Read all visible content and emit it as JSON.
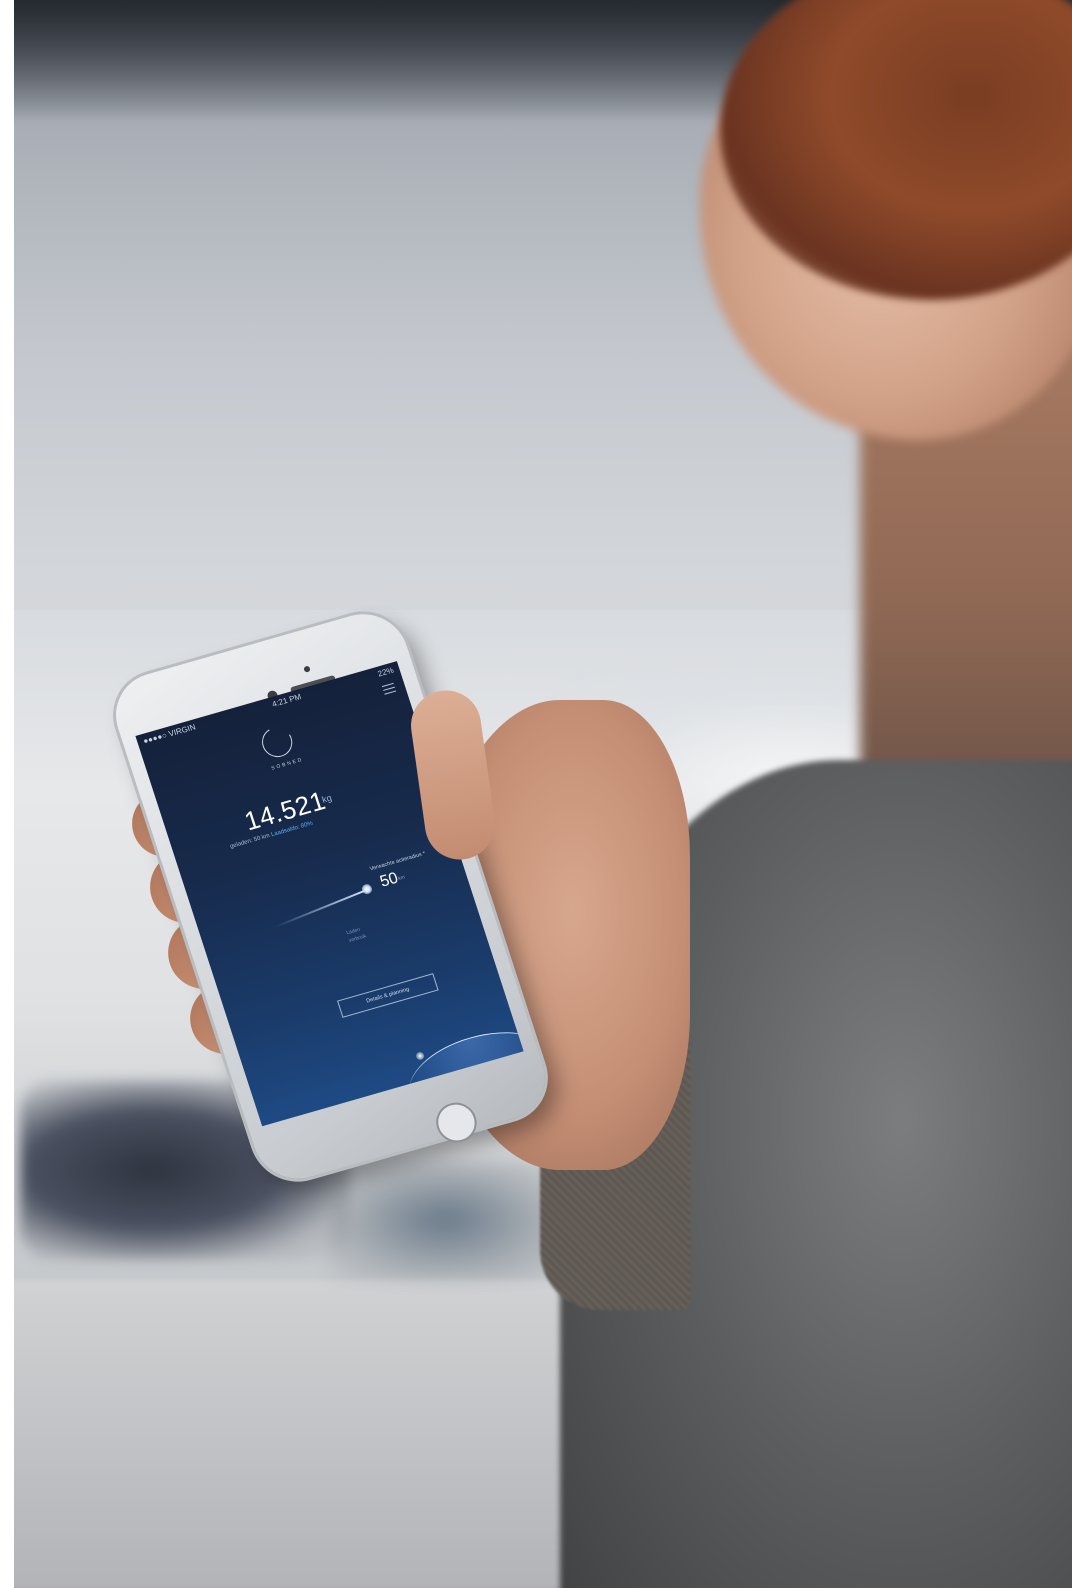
{
  "status_bar": {
    "carrier": "●●●●○ VIRGIN",
    "time": "4:21 PM",
    "battery": "22%"
  },
  "app": {
    "logo_text": "SOBNED",
    "main_value": "14.521",
    "main_unit": "kg",
    "sub_text_prefix": "geladen: 50 km",
    "sub_text_accent": "Laadsaldo: 80%",
    "range_label": "Verwachte actieradius *",
    "range_value": "50",
    "range_unit": "km",
    "faint_line_1": "Laden",
    "faint_line_2": "verbruik",
    "button_label": "Details & planning"
  },
  "colors": {
    "screen_top": "#15213b",
    "screen_bottom": "#1e4a84",
    "accent": "#4fb3ff"
  }
}
